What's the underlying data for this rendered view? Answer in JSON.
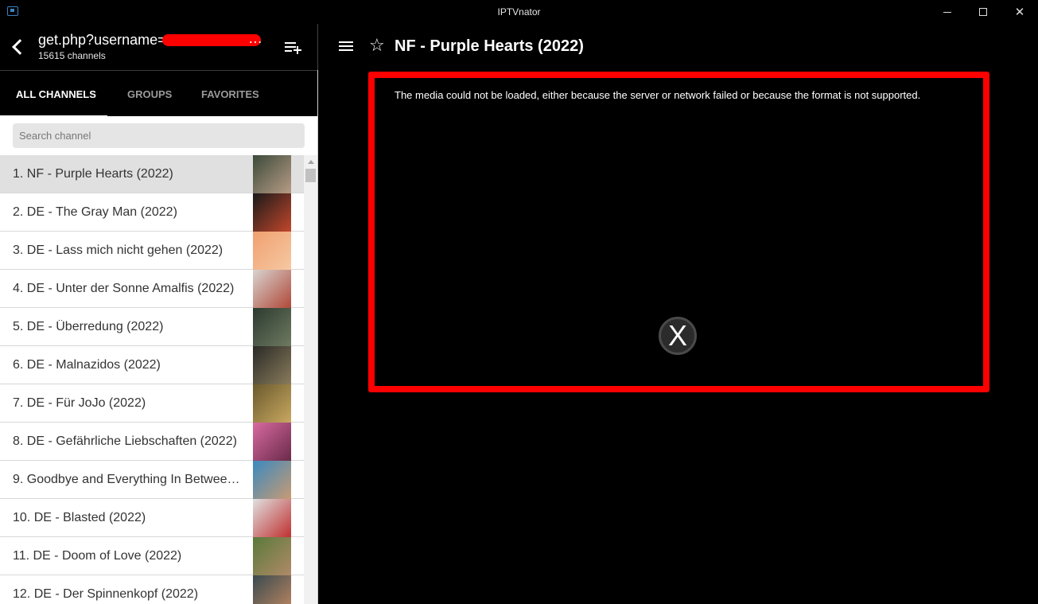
{
  "window": {
    "title": "IPTVnator",
    "close_glyph": "✕"
  },
  "sidebar": {
    "playlist_title": "get.php?username=",
    "more_glyph": "…",
    "channel_count": "15615 channels",
    "tabs": [
      {
        "label": "ALL CHANNELS"
      },
      {
        "label": "GROUPS"
      },
      {
        "label": "FAVORITES"
      }
    ],
    "search_placeholder": "Search channel",
    "channels": [
      {
        "label": "1. NF - Purple Hearts (2022)",
        "colors": [
          "#3c4a3a",
          "#b79c86"
        ]
      },
      {
        "label": "2. DE - The Gray Man (2022)",
        "colors": [
          "#1a1a1a",
          "#c2472b"
        ]
      },
      {
        "label": "3. DE - Lass mich nicht gehen (2022)",
        "colors": [
          "#f0a070",
          "#f6c8a2"
        ]
      },
      {
        "label": "4. DE - Unter der Sonne Amalfis (2022)",
        "colors": [
          "#d8d4d0",
          "#b04838"
        ]
      },
      {
        "label": "5. DE - Überredung (2022)",
        "colors": [
          "#2c3a30",
          "#6e7a60"
        ]
      },
      {
        "label": "6. DE - Malnazidos (2022)",
        "colors": [
          "#2a2a26",
          "#8a7c5c"
        ]
      },
      {
        "label": "7. DE - Für JoJo (2022)",
        "colors": [
          "#6b5a2e",
          "#c8a860"
        ]
      },
      {
        "label": "8. DE - Gefährliche Liebschaften (2022)",
        "colors": [
          "#d86aa0",
          "#6a2a4a"
        ]
      },
      {
        "label": "9. Goodbye and Everything In Between ...",
        "colors": [
          "#3a8ac0",
          "#c89a72"
        ]
      },
      {
        "label": "10. DE - Blasted (2022)",
        "colors": [
          "#e0e0e0",
          "#c03030"
        ]
      },
      {
        "label": "11. DE - Doom of Love (2022)",
        "colors": [
          "#5a7a3a",
          "#b08a68"
        ]
      },
      {
        "label": "12. DE - Der Spinnenkopf (2022)",
        "colors": [
          "#3a4a50",
          "#c08860"
        ]
      }
    ]
  },
  "main": {
    "channel_title": "NF - Purple Hearts (2022)",
    "star_glyph": "☆",
    "error_message": "The media could not be loaded, either because the server or network failed or because the format is not supported.",
    "error_glyph": "X"
  }
}
